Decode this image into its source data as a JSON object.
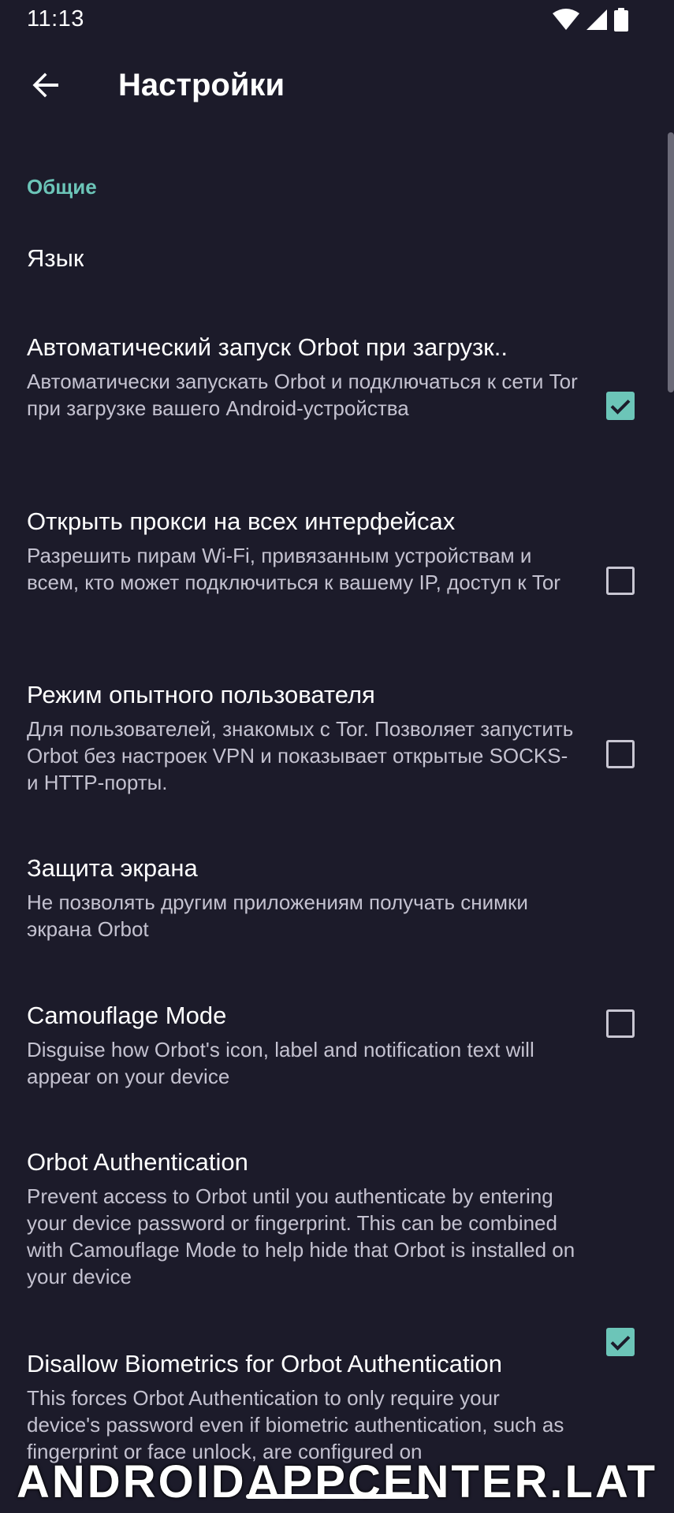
{
  "status_bar": {
    "time": "11:13"
  },
  "app_bar": {
    "title": "Настройки"
  },
  "section": {
    "header": "Общие"
  },
  "preferences": [
    {
      "title": "Язык",
      "summary": "",
      "checked": null
    },
    {
      "title": "Автоматический запуск Orbot при загрузк..",
      "summary": "Автоматически запускать Orbot и подключаться к сети Tor при загрузке вашего Android-устройства",
      "checked": true
    },
    {
      "title": "Открыть прокси на всех интерфейсах",
      "summary": "Разрешить пирам Wi-Fi, привязанным устройствам и всем, кто может подключиться к вашему IP, доступ к Tor",
      "checked": false
    },
    {
      "title": "Режим опытного пользователя",
      "summary": "Для пользователей, знакомых с Tor. Позволяет запустить Orbot без настроек VPN и показывает открытые SOCKS- и HTTP-порты.",
      "checked": false
    },
    {
      "title": "Защита экрана",
      "summary": "Не позволять другим приложениям получать снимки экрана Orbot",
      "checked": false
    },
    {
      "title": "Camouflage Mode",
      "summary": "Disguise how Orbot's icon, label and notification text will appear on your device",
      "checked": null
    },
    {
      "title": "Orbot Authentication",
      "summary": "Prevent access to Orbot until you authenticate by entering your device password or fingerprint. This can be combined with Camouflage Mode to help hide that Orbot is installed on your device",
      "checked": true
    },
    {
      "title": "Disallow Biometrics for Orbot Authentication",
      "summary": "This forces Orbot Authentication to only require your device's password even if biometric authentication, such as fingerprint or face unlock, are configured on",
      "checked": false
    }
  ],
  "watermark": "ANDROIDAPPCENTER.LAT",
  "colors": {
    "background": "#1c1b2a",
    "accent": "#6cc5b8",
    "summary_text": "#c4c2d0"
  },
  "icons": {
    "back": "arrow-left-icon",
    "wifi": "wifi-icon",
    "signal": "cell-signal-icon",
    "battery": "battery-icon",
    "check": "check-icon"
  }
}
